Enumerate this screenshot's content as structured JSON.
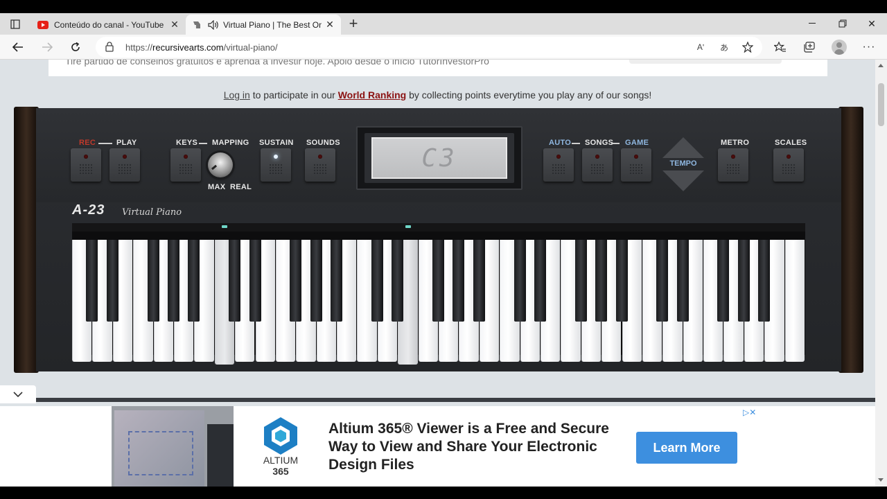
{
  "browser": {
    "tabs": [
      {
        "title": "Conteúdo do canal - YouTube St",
        "favicon": "youtube-icon"
      },
      {
        "title": "Virtual Piano | The Best Onli",
        "favicon": "piano-icon",
        "audio": true
      }
    ],
    "url_prefix": "https://",
    "url_domain": "recursivearts.com",
    "url_path": "/virtual-piano/",
    "reader_icon": "Aʹ",
    "translate_icon": "あ"
  },
  "page": {
    "ad_strip_text": "Tire partido de conselhos gratuitos e aprenda a investir hoje. Apoio desde o início TutorInvestorPro",
    "login_link": "Log in",
    "login_text_1": " to participate in our ",
    "ranking_link": "World Ranking",
    "login_text_2": " by collecting points everytime you play any of our songs!"
  },
  "piano": {
    "labels": {
      "rec": "REC",
      "play": "PLAY",
      "keys": "KEYS",
      "mapping": "MAPPING",
      "sustain": "SUSTAIN",
      "sounds": "SOUNDS",
      "max": "MAX",
      "real": "REAL",
      "auto": "AUTO",
      "songs": "SONGS",
      "game": "GAME",
      "tempo": "TEMPO",
      "metro": "METRO",
      "scales": "SCALES"
    },
    "display_note": "C3",
    "brand": "A-23",
    "brand_sub": "Virtual Piano",
    "white_key_count": 36,
    "pressed_keys": [
      7,
      16
    ]
  },
  "ad": {
    "brand_line1": "ALTIUM",
    "brand_line2": "365",
    "headline": "Altium 365® Viewer is a Free and Secure Way to View and Share Your Electronic Design Files",
    "cta": "Learn More",
    "choice": "▷✕"
  },
  "colors": {
    "accent_red": "#8b1212",
    "cta_blue": "#3d8fdf",
    "blue_label": "#8fb7e0"
  }
}
